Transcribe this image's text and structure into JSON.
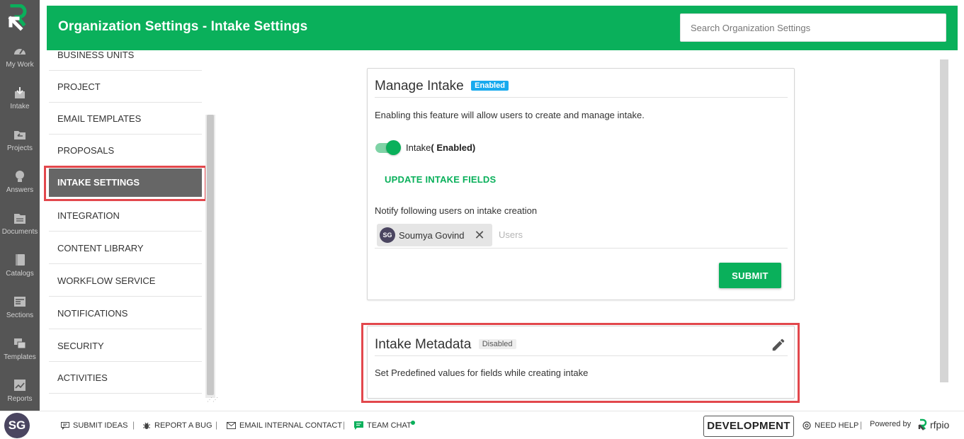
{
  "rail": {
    "items": [
      {
        "label": "My Work",
        "icon": "gauge-icon"
      },
      {
        "label": "Intake",
        "icon": "inbox-download-icon"
      },
      {
        "label": "Projects",
        "icon": "folder-back-icon"
      },
      {
        "label": "Answers",
        "icon": "lightbulb-icon"
      },
      {
        "label": "Documents",
        "icon": "documents-icon"
      },
      {
        "label": "Catalogs",
        "icon": "catalog-book-icon"
      },
      {
        "label": "Sections",
        "icon": "sections-icon"
      },
      {
        "label": "Templates",
        "icon": "templates-icon"
      },
      {
        "label": "Reports",
        "icon": "chart-icon"
      }
    ]
  },
  "header": {
    "title": "Organization Settings - Intake Settings",
    "search_placeholder": "Search Organization Settings"
  },
  "nav": {
    "items": [
      {
        "label": "BUSINESS UNITS"
      },
      {
        "label": "PROJECT"
      },
      {
        "label": "EMAIL TEMPLATES"
      },
      {
        "label": "PROPOSALS"
      },
      {
        "label": "INTAKE SETTINGS",
        "active": true
      },
      {
        "label": "INTEGRATION"
      },
      {
        "label": "CONTENT LIBRARY"
      },
      {
        "label": "WORKFLOW SERVICE"
      },
      {
        "label": "NOTIFICATIONS"
      },
      {
        "label": "SECURITY"
      },
      {
        "label": "ACTIVITIES"
      }
    ]
  },
  "manage_intake": {
    "title": "Manage Intake",
    "badge": "Enabled",
    "description": "Enabling this feature will allow users to create and manage intake.",
    "toggle_label_prefix": "Intake",
    "toggle_label_state": "( Enabled)",
    "toggle_on": true,
    "update_fields_label": "UPDATE INTAKE FIELDS",
    "notify_label": "Notify following users on intake creation",
    "users": [
      {
        "initials": "SG",
        "name": "Soumya Govind"
      }
    ],
    "users_placeholder": "Users",
    "submit_label": "SUBMIT"
  },
  "intake_metadata": {
    "title": "Intake Metadata",
    "badge": "Disabled",
    "description": "Set Predefined values for fields while creating intake"
  },
  "footer": {
    "user_initials": "SG",
    "links": [
      {
        "label": "SUBMIT IDEAS",
        "icon": "comment-icon"
      },
      {
        "label": "REPORT A BUG",
        "icon": "bug-icon"
      },
      {
        "label": "EMAIL INTERNAL CONTACT",
        "icon": "mail-icon"
      },
      {
        "label": "TEAM CHAT",
        "icon": "chat-icon"
      }
    ],
    "environment": "DEVELOPMENT",
    "need_help": "NEED HELP",
    "powered_by": "Powered by",
    "brand": "rfpio",
    "accent_color": "#0ab05b"
  }
}
